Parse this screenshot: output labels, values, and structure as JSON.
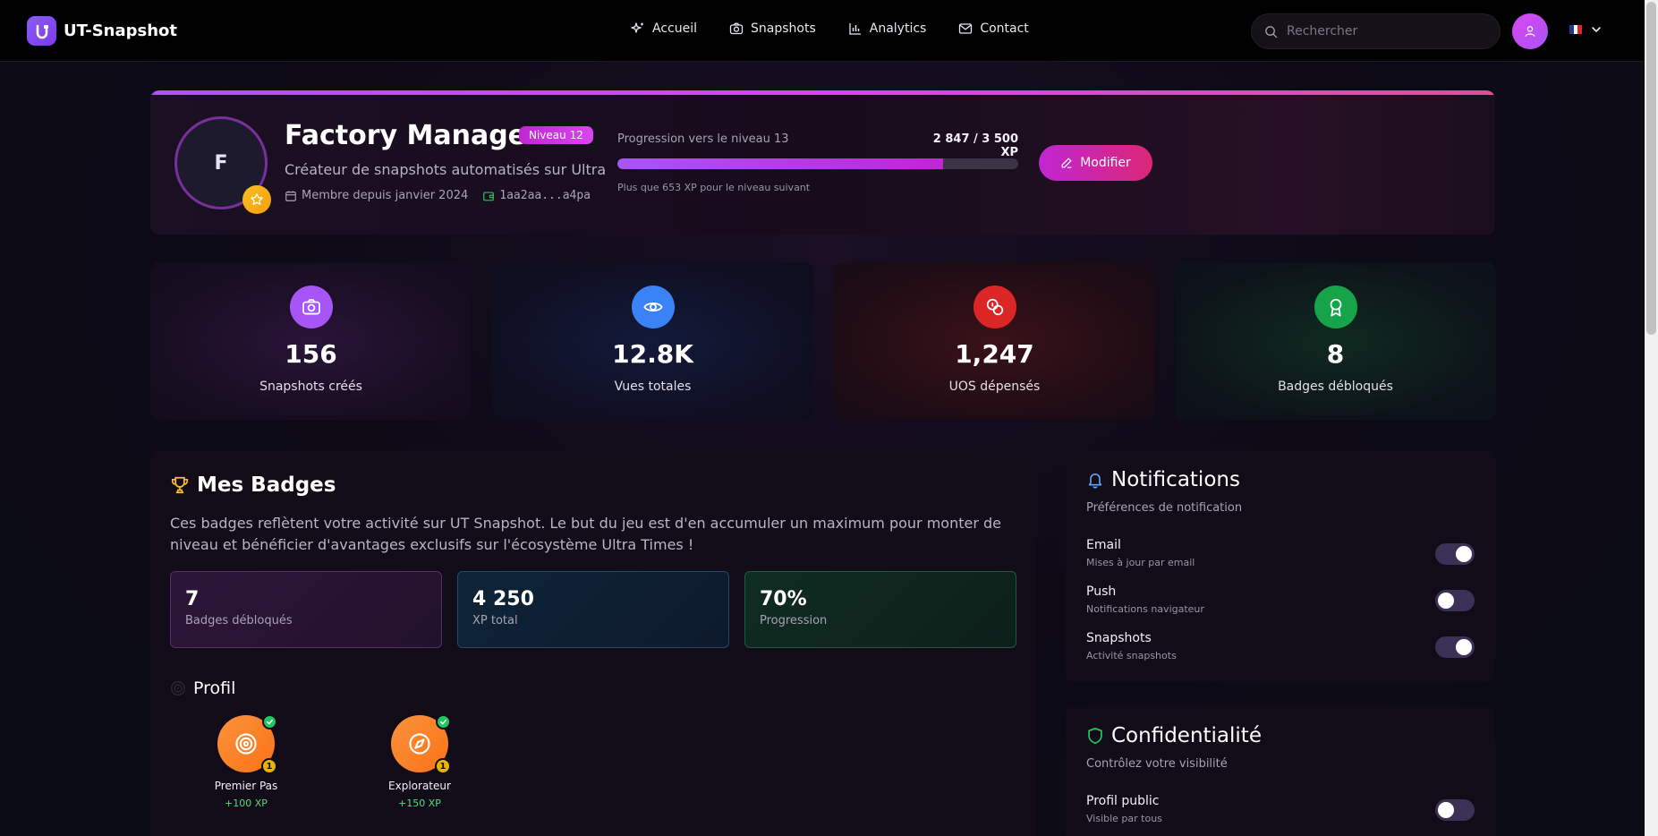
{
  "nav": {
    "brand": "UT-Snapshot",
    "links": [
      {
        "label": "Accueil",
        "icon": "sparkles-icon"
      },
      {
        "label": "Snapshots",
        "icon": "camera-icon"
      },
      {
        "label": "Analytics",
        "icon": "bar-chart-icon"
      },
      {
        "label": "Contact",
        "icon": "mail-icon"
      }
    ],
    "search_placeholder": "Rechercher",
    "language_flag": "fr-flag"
  },
  "profile": {
    "avatar_letter": "F",
    "name": "Factory Manager",
    "level_badge": "Niveau 12",
    "subtitle": "Créateur de snapshots automatisés sur Ultra",
    "member_since": "Membre depuis janvier 2024",
    "wallet": "1aa2aa...a4pa",
    "progress_label": "Progression vers le niveau 13",
    "xp_count": "2 847 / 3 500 XP",
    "xp_fraction": 0.8134,
    "xp_hint": "Plus que 653 XP pour le niveau suivant",
    "edit_label": "Modifier"
  },
  "stats": [
    {
      "value": "156",
      "label": "Snapshots créés",
      "icon": "camera-icon",
      "color": "#a855f7"
    },
    {
      "value": "12.8K",
      "label": "Vues totales",
      "icon": "eye-icon",
      "color": "#3b82f6"
    },
    {
      "value": "1,247",
      "label": "UOS dépensés",
      "icon": "coins-icon",
      "color": "#dc2626"
    },
    {
      "value": "8",
      "label": "Badges débloqués",
      "icon": "award-icon",
      "color": "#16a34a"
    }
  ],
  "badges": {
    "title": "Mes Badges",
    "description": "Ces badges reflètent votre activité sur UT Snapshot. Le but du jeu est d'en accumuler un maximum pour monter de niveau et bénéficier d'avantages exclusifs sur l'écosystème Ultra Times !",
    "summary": [
      {
        "value": "7",
        "label": "Badges débloqués"
      },
      {
        "value": "4 250",
        "label": "XP total"
      },
      {
        "value": "70%",
        "label": "Progression"
      }
    ],
    "section": "Profil",
    "items": [
      {
        "name": "Premier Pas",
        "xp": "+100 XP",
        "count": "1",
        "icon": "target-icon"
      },
      {
        "name": "Explorateur",
        "xp": "+150 XP",
        "count": "1",
        "icon": "compass-icon"
      }
    ]
  },
  "notifications": {
    "title": "Notifications",
    "subtitle": "Préférences de notification",
    "rows": [
      {
        "title": "Email",
        "desc": "Mises à jour par email",
        "on": true
      },
      {
        "title": "Push",
        "desc": "Notifications navigateur",
        "on": false
      },
      {
        "title": "Snapshots",
        "desc": "Activité snapshots",
        "on": true
      }
    ]
  },
  "privacy": {
    "title": "Confidentialité",
    "subtitle": "Contrôlez votre visibilité",
    "rows": [
      {
        "title": "Profil public",
        "desc": "Visible par tous",
        "on": false
      }
    ]
  }
}
